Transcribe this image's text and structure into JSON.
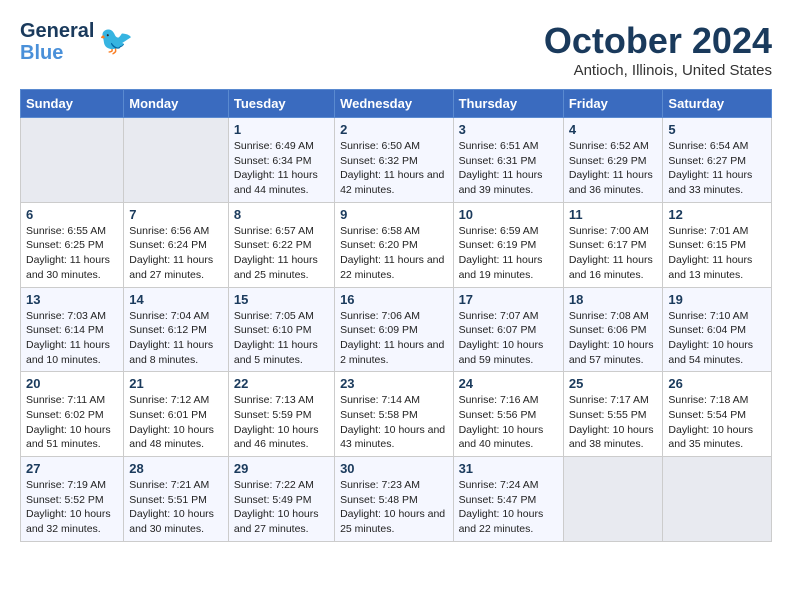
{
  "header": {
    "logo_line1": "General",
    "logo_line2": "Blue",
    "month": "October 2024",
    "location": "Antioch, Illinois, United States"
  },
  "weekdays": [
    "Sunday",
    "Monday",
    "Tuesday",
    "Wednesday",
    "Thursday",
    "Friday",
    "Saturday"
  ],
  "weeks": [
    [
      {
        "day": "",
        "info": ""
      },
      {
        "day": "",
        "info": ""
      },
      {
        "day": "1",
        "info": "Sunrise: 6:49 AM\nSunset: 6:34 PM\nDaylight: 11 hours and 44 minutes."
      },
      {
        "day": "2",
        "info": "Sunrise: 6:50 AM\nSunset: 6:32 PM\nDaylight: 11 hours and 42 minutes."
      },
      {
        "day": "3",
        "info": "Sunrise: 6:51 AM\nSunset: 6:31 PM\nDaylight: 11 hours and 39 minutes."
      },
      {
        "day": "4",
        "info": "Sunrise: 6:52 AM\nSunset: 6:29 PM\nDaylight: 11 hours and 36 minutes."
      },
      {
        "day": "5",
        "info": "Sunrise: 6:54 AM\nSunset: 6:27 PM\nDaylight: 11 hours and 33 minutes."
      }
    ],
    [
      {
        "day": "6",
        "info": "Sunrise: 6:55 AM\nSunset: 6:25 PM\nDaylight: 11 hours and 30 minutes."
      },
      {
        "day": "7",
        "info": "Sunrise: 6:56 AM\nSunset: 6:24 PM\nDaylight: 11 hours and 27 minutes."
      },
      {
        "day": "8",
        "info": "Sunrise: 6:57 AM\nSunset: 6:22 PM\nDaylight: 11 hours and 25 minutes."
      },
      {
        "day": "9",
        "info": "Sunrise: 6:58 AM\nSunset: 6:20 PM\nDaylight: 11 hours and 22 minutes."
      },
      {
        "day": "10",
        "info": "Sunrise: 6:59 AM\nSunset: 6:19 PM\nDaylight: 11 hours and 19 minutes."
      },
      {
        "day": "11",
        "info": "Sunrise: 7:00 AM\nSunset: 6:17 PM\nDaylight: 11 hours and 16 minutes."
      },
      {
        "day": "12",
        "info": "Sunrise: 7:01 AM\nSunset: 6:15 PM\nDaylight: 11 hours and 13 minutes."
      }
    ],
    [
      {
        "day": "13",
        "info": "Sunrise: 7:03 AM\nSunset: 6:14 PM\nDaylight: 11 hours and 10 minutes."
      },
      {
        "day": "14",
        "info": "Sunrise: 7:04 AM\nSunset: 6:12 PM\nDaylight: 11 hours and 8 minutes."
      },
      {
        "day": "15",
        "info": "Sunrise: 7:05 AM\nSunset: 6:10 PM\nDaylight: 11 hours and 5 minutes."
      },
      {
        "day": "16",
        "info": "Sunrise: 7:06 AM\nSunset: 6:09 PM\nDaylight: 11 hours and 2 minutes."
      },
      {
        "day": "17",
        "info": "Sunrise: 7:07 AM\nSunset: 6:07 PM\nDaylight: 10 hours and 59 minutes."
      },
      {
        "day": "18",
        "info": "Sunrise: 7:08 AM\nSunset: 6:06 PM\nDaylight: 10 hours and 57 minutes."
      },
      {
        "day": "19",
        "info": "Sunrise: 7:10 AM\nSunset: 6:04 PM\nDaylight: 10 hours and 54 minutes."
      }
    ],
    [
      {
        "day": "20",
        "info": "Sunrise: 7:11 AM\nSunset: 6:02 PM\nDaylight: 10 hours and 51 minutes."
      },
      {
        "day": "21",
        "info": "Sunrise: 7:12 AM\nSunset: 6:01 PM\nDaylight: 10 hours and 48 minutes."
      },
      {
        "day": "22",
        "info": "Sunrise: 7:13 AM\nSunset: 5:59 PM\nDaylight: 10 hours and 46 minutes."
      },
      {
        "day": "23",
        "info": "Sunrise: 7:14 AM\nSunset: 5:58 PM\nDaylight: 10 hours and 43 minutes."
      },
      {
        "day": "24",
        "info": "Sunrise: 7:16 AM\nSunset: 5:56 PM\nDaylight: 10 hours and 40 minutes."
      },
      {
        "day": "25",
        "info": "Sunrise: 7:17 AM\nSunset: 5:55 PM\nDaylight: 10 hours and 38 minutes."
      },
      {
        "day": "26",
        "info": "Sunrise: 7:18 AM\nSunset: 5:54 PM\nDaylight: 10 hours and 35 minutes."
      }
    ],
    [
      {
        "day": "27",
        "info": "Sunrise: 7:19 AM\nSunset: 5:52 PM\nDaylight: 10 hours and 32 minutes."
      },
      {
        "day": "28",
        "info": "Sunrise: 7:21 AM\nSunset: 5:51 PM\nDaylight: 10 hours and 30 minutes."
      },
      {
        "day": "29",
        "info": "Sunrise: 7:22 AM\nSunset: 5:49 PM\nDaylight: 10 hours and 27 minutes."
      },
      {
        "day": "30",
        "info": "Sunrise: 7:23 AM\nSunset: 5:48 PM\nDaylight: 10 hours and 25 minutes."
      },
      {
        "day": "31",
        "info": "Sunrise: 7:24 AM\nSunset: 5:47 PM\nDaylight: 10 hours and 22 minutes."
      },
      {
        "day": "",
        "info": ""
      },
      {
        "day": "",
        "info": ""
      }
    ]
  ]
}
